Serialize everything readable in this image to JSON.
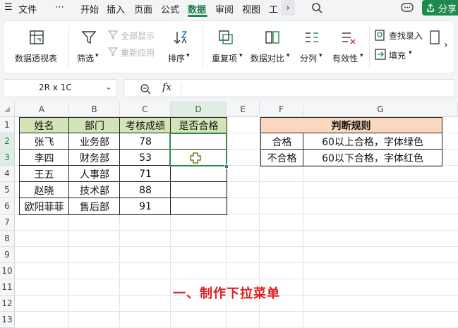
{
  "menu": {
    "file": "文件",
    "more": "⋯",
    "tabs": [
      "开始",
      "插入",
      "页面",
      "公式",
      "数据",
      "审阅",
      "视图",
      "工"
    ],
    "share": "分享"
  },
  "ribbon": {
    "pivot": "数据透视表",
    "filter": "筛选",
    "show_all": "全部显示",
    "reapply": "重新应用",
    "sort": "排序",
    "duplicates": "重复项",
    "compare": "数据对比",
    "split": "分列",
    "validity": "有效性",
    "find_entry": "查找录入",
    "fill": "填充"
  },
  "formula_bar": {
    "name_box": "2R x 1C",
    "fx": "fx",
    "formula": ""
  },
  "columns": [
    "A",
    "B",
    "C",
    "D",
    "E",
    "F",
    "G"
  ],
  "rows": [
    "1",
    "2",
    "3",
    "4",
    "5",
    "6",
    "7",
    "8",
    "9",
    "10",
    "11",
    "12",
    "13"
  ],
  "table": {
    "headers": [
      "姓名",
      "部门",
      "考核成绩",
      "是否合格"
    ],
    "rows": [
      [
        "张飞",
        "业务部",
        "78",
        ""
      ],
      [
        "李四",
        "财务部",
        "53",
        ""
      ],
      [
        "王五",
        "人事部",
        "71",
        ""
      ],
      [
        "赵晓",
        "技术部",
        "88",
        ""
      ],
      [
        "欧阳菲菲",
        "售后部",
        "91",
        ""
      ]
    ]
  },
  "rules": {
    "title": "判断规则",
    "rows": [
      [
        "合格",
        "60以上合格，字体绿色"
      ],
      [
        "不合格",
        "60以下合格，字体红色"
      ]
    ]
  },
  "caption": "一、制作下拉菜单",
  "colors": {
    "accent": "#1d8a4e",
    "header_fill": "#d3e4b7",
    "rule_header_fill": "#fbd7bd",
    "caption": "#e02020"
  }
}
